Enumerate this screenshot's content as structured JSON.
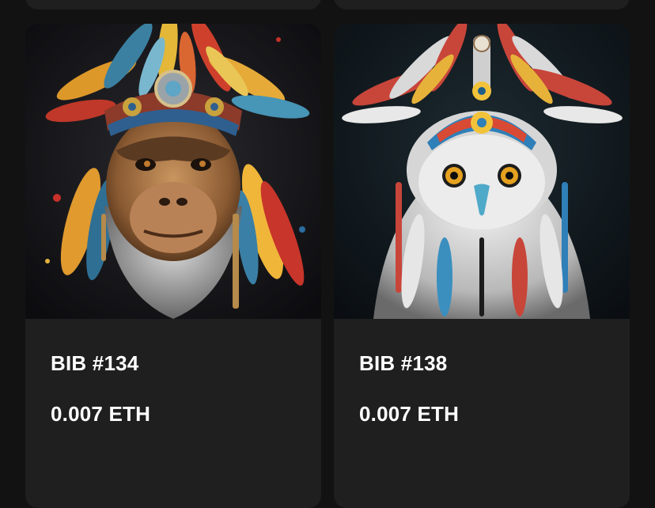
{
  "nft_cards": [
    {
      "name": "BIB #134",
      "price": "0.007 ETH",
      "image_subject": "chimpanzee-with-feather-headdress"
    },
    {
      "name": "BIB #138",
      "price": "0.007 ETH",
      "image_subject": "owl-with-feather-headdress"
    }
  ],
  "colors": {
    "page_background": "#121212",
    "card_background": "#1f1f20",
    "text": "#ffffff"
  }
}
